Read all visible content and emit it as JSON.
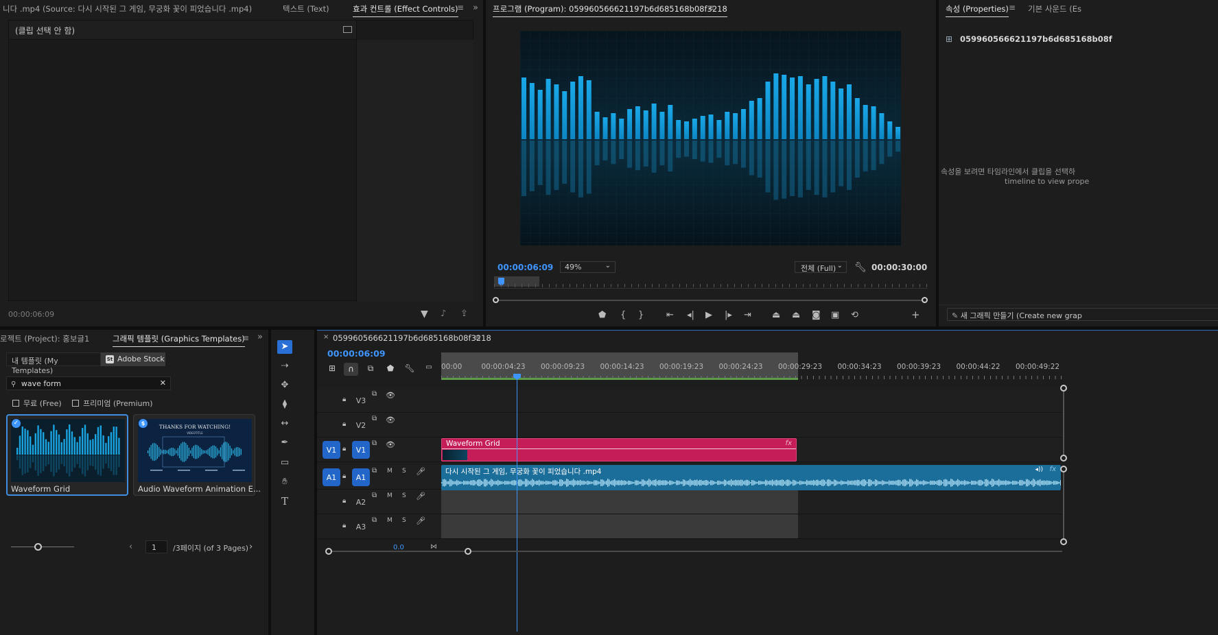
{
  "source_panel": {
    "tabs": [
      "니다 .mp4 (Source: 다시 시작된 그 게임, 무궁화 꽃이 피었습니다 .mp4)",
      "텍스트 (Text)",
      "효과 컨트롤 (Effect Controls)"
    ],
    "no_clip_label": "(클립 선택 안 함)",
    "timecode": "00:00:06:09"
  },
  "program_panel": {
    "title": "프로그램 (Program): 059960566621197b6d685168b08f3218",
    "timecode": "00:00:06:09",
    "zoom": "49%",
    "quality": "전체 (Full)",
    "duration": "00:00:30:00"
  },
  "properties_panel": {
    "tabs": [
      "속성 (Properties)",
      "기본 사운드 (Es"
    ],
    "clip_name": "059960566621197b6d685168b08f",
    "message_line1": "속성을 보려면 타임라인에서 클립을 선택하",
    "message_line2": "timeline to view prope",
    "new_graphic_button": "새 그래픽 만들기 (Create new grap"
  },
  "templates_panel": {
    "tabs": [
      "로젝트 (Project): 홍보글1",
      "그래픽 템플릿 (Graphics Templates)"
    ],
    "subtabs": [
      "내 템플릿 (My Templates)",
      "Adobe Stock"
    ],
    "stock_badge": "St",
    "search_value": "wave form",
    "filters": [
      "무료 (Free)",
      "프리미엄 (Premium)"
    ],
    "cards": [
      {
        "title": "Waveform Grid",
        "selected": true
      },
      {
        "title": "Audio Waveform Animation E...",
        "selected": false,
        "thumb_heading": "THANKS FOR WATCHING!",
        "thumb_sub": "VIDEOTITLE"
      }
    ],
    "page_value": "1",
    "page_text": "/3페이지 (of 3 Pages)"
  },
  "timeline": {
    "sequence_name": "059960566621197b6d685168b08f3218",
    "timecode": "00:00:06:09",
    "ruler_labels": [
      "00:00",
      "00:00:04:23",
      "00:00:09:23",
      "00:00:14:23",
      "00:00:19:23",
      "00:00:24:23",
      "00:00:29:23",
      "00:00:34:23",
      "00:00:39:23",
      "00:00:44:22",
      "00:00:49:22"
    ],
    "video_tracks": [
      {
        "src": "",
        "name": "V3"
      },
      {
        "src": "",
        "name": "V2"
      },
      {
        "src": "V1",
        "name": "V1"
      }
    ],
    "audio_tracks": [
      {
        "src": "A1",
        "name": "A1"
      },
      {
        "src": "",
        "name": "A2"
      },
      {
        "src": "",
        "name": "A3"
      }
    ],
    "mute_label": "M",
    "solo_label": "S",
    "video_clip": "Waveform Grid",
    "audio_clip": "다시 시작된 그 게임, 무궁화 꽃이 피었습니다 .mp4",
    "fx_label": "fx",
    "mix_value": "0.0",
    "playhead_fraction": 0.125
  },
  "colors": {
    "accent_blue": "#3f95ff",
    "video_clip": "#c41d58",
    "audio_clip": "#1c6e9a",
    "panel_bg": "#1d1d1d"
  }
}
